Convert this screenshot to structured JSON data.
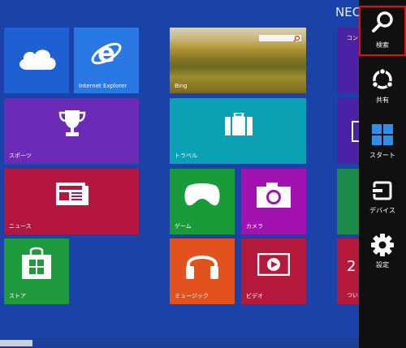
{
  "user": {
    "name": "NEC"
  },
  "tiles": {
    "skydrive": {
      "label": ""
    },
    "ie": {
      "label": "Internet Explorer"
    },
    "bing": {
      "label": "Bing"
    },
    "store_partial": {
      "label": "コン"
    },
    "sports": {
      "label": "スポーツ"
    },
    "travel": {
      "label": "トラベル"
    },
    "news": {
      "label": "ニュース"
    },
    "games": {
      "label": "ゲーム"
    },
    "camera": {
      "label": "カメラ"
    },
    "store": {
      "label": "ストア"
    },
    "music": {
      "label": "ミュージック"
    },
    "video": {
      "label": "ビデオ"
    },
    "calendar_partial": {
      "label": "つい",
      "number": "2"
    }
  },
  "charms": {
    "search": {
      "label": "検索"
    },
    "share": {
      "label": "共有"
    },
    "start": {
      "label": "スタート"
    },
    "devices": {
      "label": "デバイス"
    },
    "settings": {
      "label": "設定"
    }
  },
  "colors": {
    "background": "#1b42a8",
    "charm_bar": "#101010",
    "highlight": "#e01010"
  }
}
